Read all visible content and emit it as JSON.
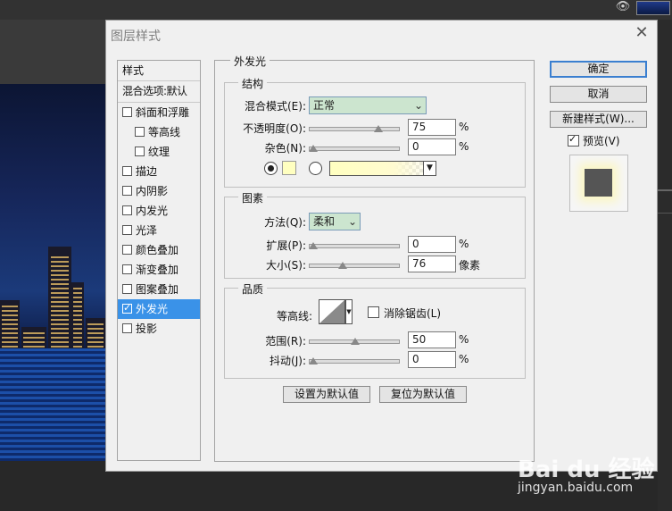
{
  "dialog": {
    "title": "图层样式",
    "close_icon": "close-icon"
  },
  "left_panel": {
    "header": "样式",
    "blend_options": "混合选项:默认",
    "items": [
      {
        "label": "斜面和浮雕",
        "checked": false
      },
      {
        "label": "等高线",
        "checked": false
      },
      {
        "label": "纹理",
        "checked": false
      },
      {
        "label": "描边",
        "checked": false
      },
      {
        "label": "内阴影",
        "checked": false
      },
      {
        "label": "内发光",
        "checked": false
      },
      {
        "label": "光泽",
        "checked": false
      },
      {
        "label": "颜色叠加",
        "checked": false
      },
      {
        "label": "渐变叠加",
        "checked": false
      },
      {
        "label": "图案叠加",
        "checked": false
      },
      {
        "label": "外发光",
        "checked": true,
        "selected": true
      },
      {
        "label": "投影",
        "checked": false
      }
    ]
  },
  "outer_glow": {
    "title": "外发光",
    "structure": {
      "title": "结构",
      "blend_mode_label": "混合模式(E):",
      "blend_mode_value": "正常",
      "opacity_label": "不透明度(O):",
      "opacity_value": "75",
      "opacity_unit": "%",
      "noise_label": "杂色(N):",
      "noise_value": "0",
      "noise_unit": "%",
      "color_mode": "solid",
      "glow_color": "#ffffc0"
    },
    "elements": {
      "title": "图素",
      "method_label": "方法(Q):",
      "method_value": "柔和",
      "spread_label": "扩展(P):",
      "spread_value": "0",
      "spread_unit": "%",
      "size_label": "大小(S):",
      "size_value": "76",
      "size_unit": "像素"
    },
    "quality": {
      "title": "品质",
      "contour_label": "等高线:",
      "anti_alias_label": "消除锯齿(L)",
      "anti_alias_checked": false,
      "range_label": "范围(R):",
      "range_value": "50",
      "range_unit": "%",
      "jitter_label": "抖动(J):",
      "jitter_value": "0",
      "jitter_unit": "%"
    },
    "make_default": "设置为默认值",
    "reset_default": "复位为默认值"
  },
  "right_buttons": {
    "ok": "确定",
    "cancel": "取消",
    "new_style": "新建样式(W)...",
    "preview_label": "预览(V)",
    "preview_checked": true
  },
  "watermark": {
    "logo": "Bai du 经验",
    "url": "jingyan.baidu.com"
  }
}
